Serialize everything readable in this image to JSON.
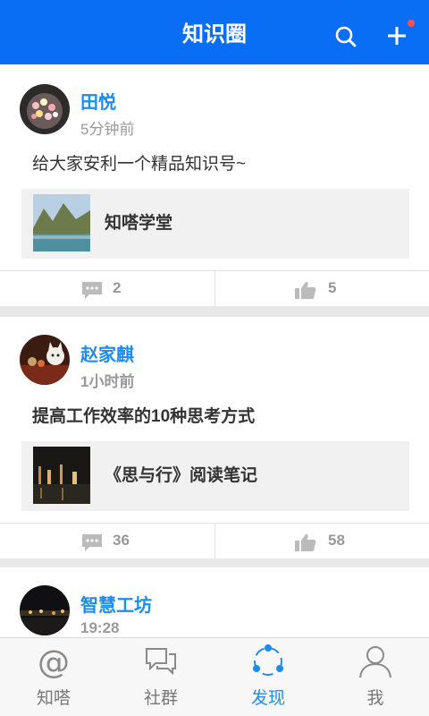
{
  "header": {
    "title": "知识圈",
    "search_icon": "search-icon",
    "add_icon": "plus-icon",
    "notification_color": "#ff4d4d",
    "background": "#0a6ef5"
  },
  "posts": [
    {
      "user": "田悦",
      "time": "5分钟前",
      "text": "给大家安利一个精品知识号~",
      "share_title": "知嗒学堂",
      "comments": "2",
      "likes": "5"
    },
    {
      "user": "赵家麒",
      "time": "1小时前",
      "text": "提高工作效率的10种思考方式",
      "share_title": "《思与行》阅读笔记",
      "comments": "36",
      "likes": "58"
    },
    {
      "user": "智慧工坊",
      "time": "19:28"
    }
  ],
  "tabbar": {
    "items": [
      {
        "label": "知嗒",
        "icon": "at-icon"
      },
      {
        "label": "社群",
        "icon": "chat-bubbles-icon"
      },
      {
        "label": "发现",
        "icon": "discover-icon",
        "active": true
      },
      {
        "label": "我",
        "icon": "person-icon"
      }
    ],
    "active_color": "#1c8cf0"
  }
}
